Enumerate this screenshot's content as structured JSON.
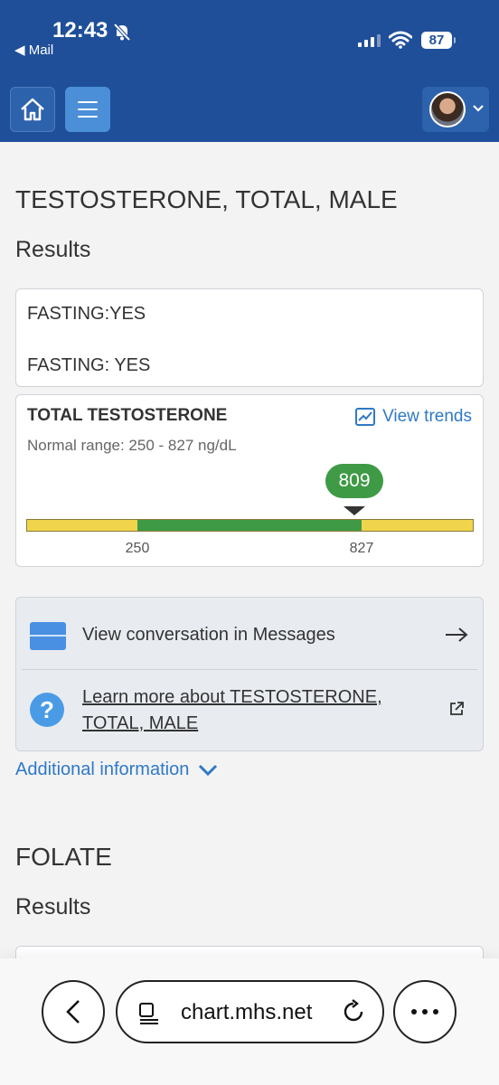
{
  "status_bar": {
    "time": "12:43",
    "back_app": "◀ Mail",
    "battery": "87"
  },
  "header": {
    "home_icon": "home-icon",
    "menu_icon": "hamburger-menu-icon",
    "account_icon": "avatar"
  },
  "section1": {
    "title": "TESTOSTERONE, TOTAL, MALE",
    "results_heading": "Results",
    "notes": [
      "FASTING:YES",
      "FASTING: YES"
    ],
    "result": {
      "name": "TOTAL TESTOSTERONE",
      "view_trends": "View trends",
      "normal_range": "Normal range: 250 - 827 ng/dL",
      "value": "809",
      "low": "250",
      "high": "827"
    },
    "links": {
      "messages": "View conversation in Messages",
      "learn_more": "Learn more about TESTOSTERONE, TOTAL, MALE"
    },
    "additional_info": "Additional information"
  },
  "section2": {
    "title": "FOLATE",
    "results_heading": "Results"
  },
  "browser": {
    "url": "chart.mhs.net"
  },
  "colors": {
    "header": "#1f4f99",
    "normal": "#3f9a46",
    "out_of_range": "#f0d44c",
    "link": "#2f79c6"
  }
}
